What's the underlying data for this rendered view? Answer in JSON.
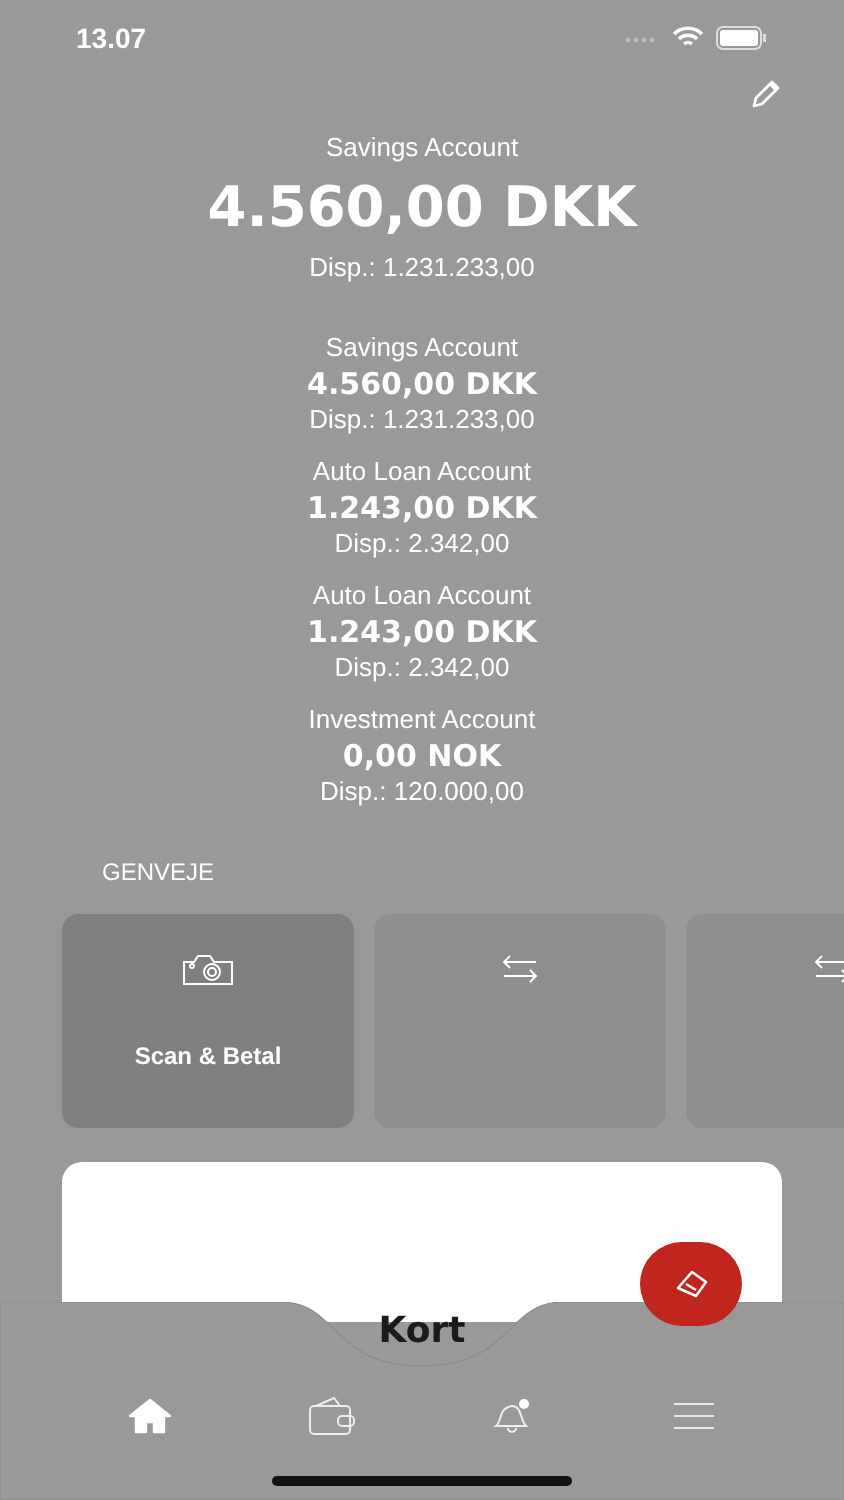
{
  "status_bar": {
    "time": "13.07"
  },
  "main_account": {
    "name": "Savings Account",
    "balance": "4.560,00 DKK",
    "available": "Disp.: 1.231.233,00"
  },
  "accounts": [
    {
      "name": "Savings Account",
      "balance": "4.560,00 DKK",
      "available": "Disp.: 1.231.233,00"
    },
    {
      "name": "Auto Loan Account",
      "balance": "1.243,00 DKK",
      "available": "Disp.: 2.342,00"
    },
    {
      "name": "Auto Loan Account",
      "balance": "1.243,00 DKK",
      "available": "Disp.: 2.342,00"
    },
    {
      "name": "Investment Account",
      "balance": "0,00 NOK",
      "available": "Disp.: 120.000,00"
    }
  ],
  "shortcuts": {
    "title": "GENVEJE",
    "items": [
      {
        "kind": "camera",
        "label": "Scan & Betal",
        "selected": true
      },
      {
        "kind": "transfer",
        "selected": false
      },
      {
        "kind": "transfer",
        "selected": false
      }
    ]
  },
  "cards_tab": {
    "label": "Kort"
  },
  "nav": [
    {
      "kind": "home",
      "selected": true
    },
    {
      "kind": "wallet",
      "selected": false
    },
    {
      "kind": "bell",
      "selected": false
    },
    {
      "kind": "menu",
      "selected": false
    }
  ]
}
